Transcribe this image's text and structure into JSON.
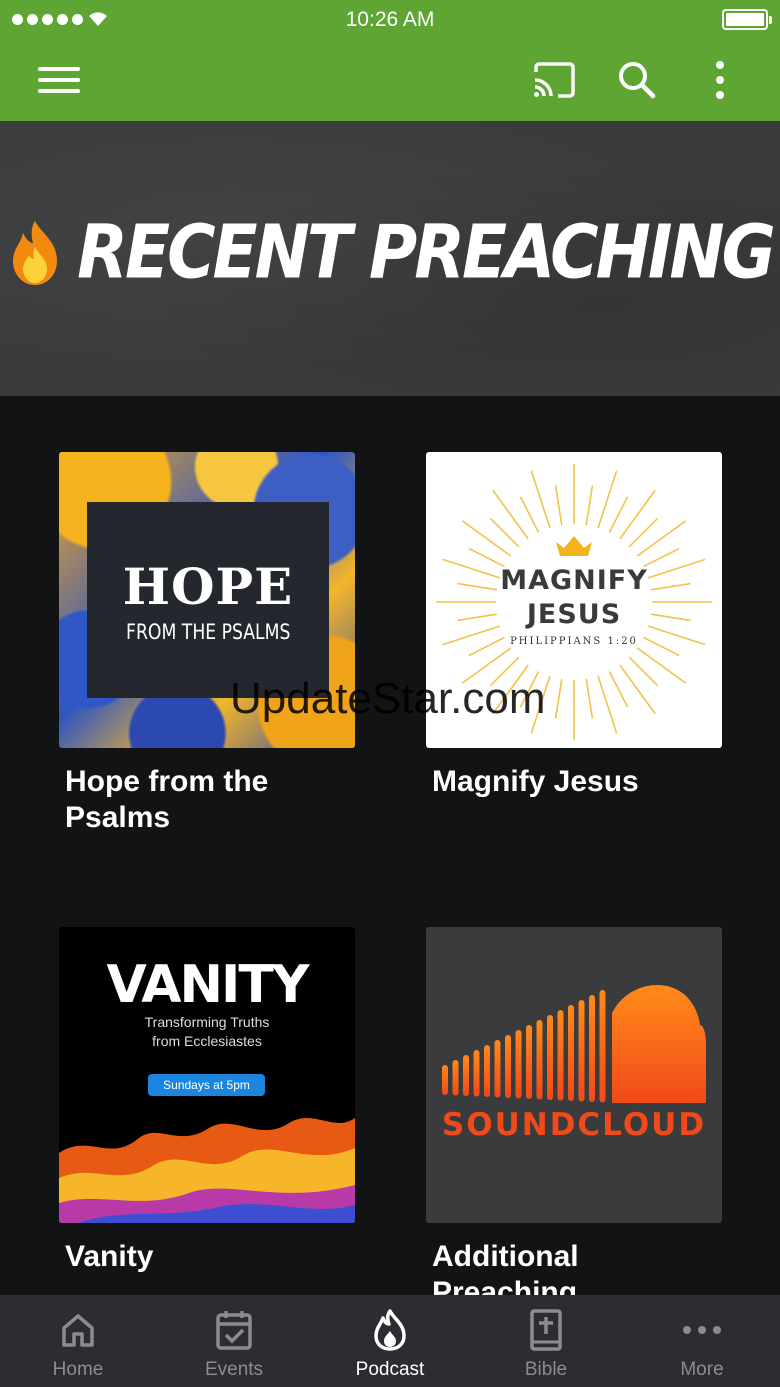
{
  "status_bar": {
    "time": "10:26 AM"
  },
  "app_bar": {
    "menu_icon": "hamburger-menu-icon",
    "cast_icon": "cast-icon",
    "search_icon": "search-icon",
    "more_icon": "more-vertical-icon",
    "background_color": "#5fa534"
  },
  "hero": {
    "title": "RECENT PREACHING",
    "icon": "fire-icon"
  },
  "podcasts": [
    {
      "title": "Hope from the Psalms",
      "art": {
        "main": "HOPE",
        "sub": "FROM THE PSALMS"
      }
    },
    {
      "title": "Magnify Jesus",
      "art": {
        "line1": "MAGNIFY",
        "line2": "JESUS",
        "verse": "PHILIPPIANS 1:20"
      }
    },
    {
      "title": "Vanity",
      "art": {
        "main": "VANITY",
        "sub1": "Transforming Truths",
        "sub2": "from Ecclesiastes",
        "pill": "Sundays at 5pm"
      }
    },
    {
      "title": "Additional Preaching",
      "art": {
        "wordmark": "SOUNDCLOUD",
        "icon": "soundcloud-icon"
      }
    }
  ],
  "watermark": "UpdateStar.com",
  "tabs": [
    {
      "label": "Home",
      "icon": "home-icon",
      "active": false
    },
    {
      "label": "Events",
      "icon": "calendar-check-icon",
      "active": false
    },
    {
      "label": "Podcast",
      "icon": "flame-icon",
      "active": true
    },
    {
      "label": "Bible",
      "icon": "bible-icon",
      "active": false
    },
    {
      "label": "More",
      "icon": "more-horizontal-icon",
      "active": false
    }
  ],
  "colors": {
    "accent": "#5fa534",
    "background": "#121315",
    "tabbar": "#2c2d30",
    "tab_inactive": "#8c8c8e",
    "tab_active": "#ffffff"
  }
}
